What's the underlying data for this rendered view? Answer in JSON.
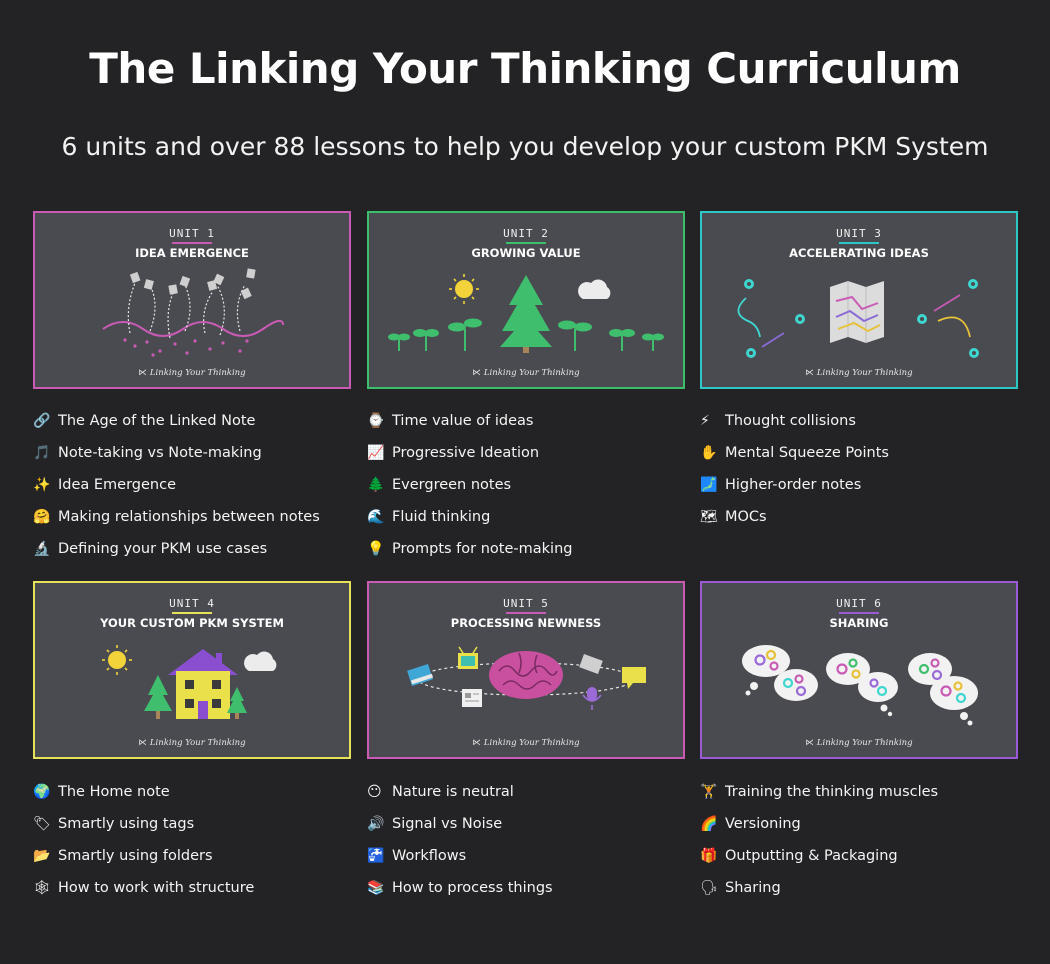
{
  "header": {
    "title": "The Linking Your Thinking Curriculum",
    "subtitle": "6 units and over 88 lessons to help you develop your custom PKM System"
  },
  "brand_label": "Linking Your Thinking",
  "units": [
    {
      "number_label": "UNIT 1",
      "name": "IDEA EMERGENCE",
      "border_color": "#c95bb4",
      "lessons": [
        {
          "icon": "🔗",
          "label": "The Age of the Linked Note"
        },
        {
          "icon": "🎵",
          "label": "Note-taking vs Note-making"
        },
        {
          "icon": "✨",
          "label": "Idea Emergence"
        },
        {
          "icon": "🤗",
          "label": "Making relationships between notes"
        },
        {
          "icon": "🔬",
          "label": "Defining your PKM use cases"
        }
      ]
    },
    {
      "number_label": "UNIT 2",
      "name": "GROWING VALUE",
      "border_color": "#3bbf6a",
      "lessons": [
        {
          "icon": "⌚",
          "label": "Time value of ideas"
        },
        {
          "icon": "📈",
          "label": "Progressive Ideation"
        },
        {
          "icon": "🌲",
          "label": "Evergreen notes"
        },
        {
          "icon": "🌊",
          "label": "Fluid thinking"
        },
        {
          "icon": "💡",
          "label": "Prompts for note-making"
        }
      ]
    },
    {
      "number_label": "UNIT 3",
      "name": "ACCELERATING IDEAS",
      "border_color": "#2dc7c7",
      "lessons": [
        {
          "icon": "⚡",
          "label": "Thought collisions"
        },
        {
          "icon": "✋",
          "label": "Mental Squeeze Points"
        },
        {
          "icon": "🗾",
          "label": "Higher-order notes"
        },
        {
          "icon": "🗺",
          "label": "MOCs"
        }
      ]
    },
    {
      "number_label": "UNIT 4",
      "name": "YOUR CUSTOM PKM SYSTEM",
      "border_color": "#e6e25a",
      "lessons": [
        {
          "icon": "🌍",
          "label": "The Home note"
        },
        {
          "icon": "🏷",
          "label": "Smartly using tags"
        },
        {
          "icon": "📂",
          "label": "Smartly using folders"
        },
        {
          "icon": "🕸",
          "label": "How to work with structure"
        }
      ]
    },
    {
      "number_label": "UNIT 5",
      "name": "PROCESSING NEWNESS",
      "border_color": "#c95bb4",
      "lessons": [
        {
          "icon": "😶",
          "label": "Nature is neutral"
        },
        {
          "icon": "🔊",
          "label": "Signal vs Noise"
        },
        {
          "icon": "🚰",
          "label": "Workflows"
        },
        {
          "icon": "📚",
          "label": "How to process things"
        }
      ]
    },
    {
      "number_label": "UNIT 6",
      "name": "SHARING",
      "border_color": "#9b5ad6",
      "lessons": [
        {
          "icon": "🏋",
          "label": "Training the thinking muscles"
        },
        {
          "icon": "🌈",
          "label": "Versioning"
        },
        {
          "icon": "🎁",
          "label": "Outputting & Packaging"
        },
        {
          "icon": "🗣",
          "label": "Sharing"
        }
      ]
    }
  ]
}
